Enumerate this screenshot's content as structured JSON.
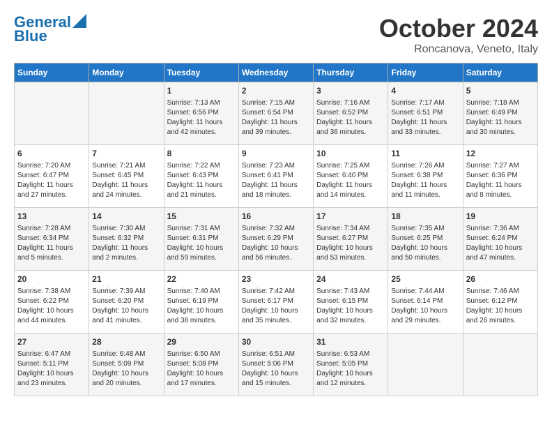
{
  "header": {
    "logo_line1": "General",
    "logo_line2": "Blue",
    "month": "October 2024",
    "location": "Roncanova, Veneto, Italy"
  },
  "weekdays": [
    "Sunday",
    "Monday",
    "Tuesday",
    "Wednesday",
    "Thursday",
    "Friday",
    "Saturday"
  ],
  "weeks": [
    [
      {
        "day": "",
        "text": ""
      },
      {
        "day": "",
        "text": ""
      },
      {
        "day": "1",
        "text": "Sunrise: 7:13 AM\nSunset: 6:56 PM\nDaylight: 11 hours and 42 minutes."
      },
      {
        "day": "2",
        "text": "Sunrise: 7:15 AM\nSunset: 6:54 PM\nDaylight: 11 hours and 39 minutes."
      },
      {
        "day": "3",
        "text": "Sunrise: 7:16 AM\nSunset: 6:52 PM\nDaylight: 11 hours and 36 minutes."
      },
      {
        "day": "4",
        "text": "Sunrise: 7:17 AM\nSunset: 6:51 PM\nDaylight: 11 hours and 33 minutes."
      },
      {
        "day": "5",
        "text": "Sunrise: 7:18 AM\nSunset: 6:49 PM\nDaylight: 11 hours and 30 minutes."
      }
    ],
    [
      {
        "day": "6",
        "text": "Sunrise: 7:20 AM\nSunset: 6:47 PM\nDaylight: 11 hours and 27 minutes."
      },
      {
        "day": "7",
        "text": "Sunrise: 7:21 AM\nSunset: 6:45 PM\nDaylight: 11 hours and 24 minutes."
      },
      {
        "day": "8",
        "text": "Sunrise: 7:22 AM\nSunset: 6:43 PM\nDaylight: 11 hours and 21 minutes."
      },
      {
        "day": "9",
        "text": "Sunrise: 7:23 AM\nSunset: 6:41 PM\nDaylight: 11 hours and 18 minutes."
      },
      {
        "day": "10",
        "text": "Sunrise: 7:25 AM\nSunset: 6:40 PM\nDaylight: 11 hours and 14 minutes."
      },
      {
        "day": "11",
        "text": "Sunrise: 7:26 AM\nSunset: 6:38 PM\nDaylight: 11 hours and 11 minutes."
      },
      {
        "day": "12",
        "text": "Sunrise: 7:27 AM\nSunset: 6:36 PM\nDaylight: 11 hours and 8 minutes."
      }
    ],
    [
      {
        "day": "13",
        "text": "Sunrise: 7:28 AM\nSunset: 6:34 PM\nDaylight: 11 hours and 5 minutes."
      },
      {
        "day": "14",
        "text": "Sunrise: 7:30 AM\nSunset: 6:32 PM\nDaylight: 11 hours and 2 minutes."
      },
      {
        "day": "15",
        "text": "Sunrise: 7:31 AM\nSunset: 6:31 PM\nDaylight: 10 hours and 59 minutes."
      },
      {
        "day": "16",
        "text": "Sunrise: 7:32 AM\nSunset: 6:29 PM\nDaylight: 10 hours and 56 minutes."
      },
      {
        "day": "17",
        "text": "Sunrise: 7:34 AM\nSunset: 6:27 PM\nDaylight: 10 hours and 53 minutes."
      },
      {
        "day": "18",
        "text": "Sunrise: 7:35 AM\nSunset: 6:25 PM\nDaylight: 10 hours and 50 minutes."
      },
      {
        "day": "19",
        "text": "Sunrise: 7:36 AM\nSunset: 6:24 PM\nDaylight: 10 hours and 47 minutes."
      }
    ],
    [
      {
        "day": "20",
        "text": "Sunrise: 7:38 AM\nSunset: 6:22 PM\nDaylight: 10 hours and 44 minutes."
      },
      {
        "day": "21",
        "text": "Sunrise: 7:39 AM\nSunset: 6:20 PM\nDaylight: 10 hours and 41 minutes."
      },
      {
        "day": "22",
        "text": "Sunrise: 7:40 AM\nSunset: 6:19 PM\nDaylight: 10 hours and 38 minutes."
      },
      {
        "day": "23",
        "text": "Sunrise: 7:42 AM\nSunset: 6:17 PM\nDaylight: 10 hours and 35 minutes."
      },
      {
        "day": "24",
        "text": "Sunrise: 7:43 AM\nSunset: 6:15 PM\nDaylight: 10 hours and 32 minutes."
      },
      {
        "day": "25",
        "text": "Sunrise: 7:44 AM\nSunset: 6:14 PM\nDaylight: 10 hours and 29 minutes."
      },
      {
        "day": "26",
        "text": "Sunrise: 7:46 AM\nSunset: 6:12 PM\nDaylight: 10 hours and 26 minutes."
      }
    ],
    [
      {
        "day": "27",
        "text": "Sunrise: 6:47 AM\nSunset: 5:11 PM\nDaylight: 10 hours and 23 minutes."
      },
      {
        "day": "28",
        "text": "Sunrise: 6:48 AM\nSunset: 5:09 PM\nDaylight: 10 hours and 20 minutes."
      },
      {
        "day": "29",
        "text": "Sunrise: 6:50 AM\nSunset: 5:08 PM\nDaylight: 10 hours and 17 minutes."
      },
      {
        "day": "30",
        "text": "Sunrise: 6:51 AM\nSunset: 5:06 PM\nDaylight: 10 hours and 15 minutes."
      },
      {
        "day": "31",
        "text": "Sunrise: 6:53 AM\nSunset: 5:05 PM\nDaylight: 10 hours and 12 minutes."
      },
      {
        "day": "",
        "text": ""
      },
      {
        "day": "",
        "text": ""
      }
    ]
  ]
}
